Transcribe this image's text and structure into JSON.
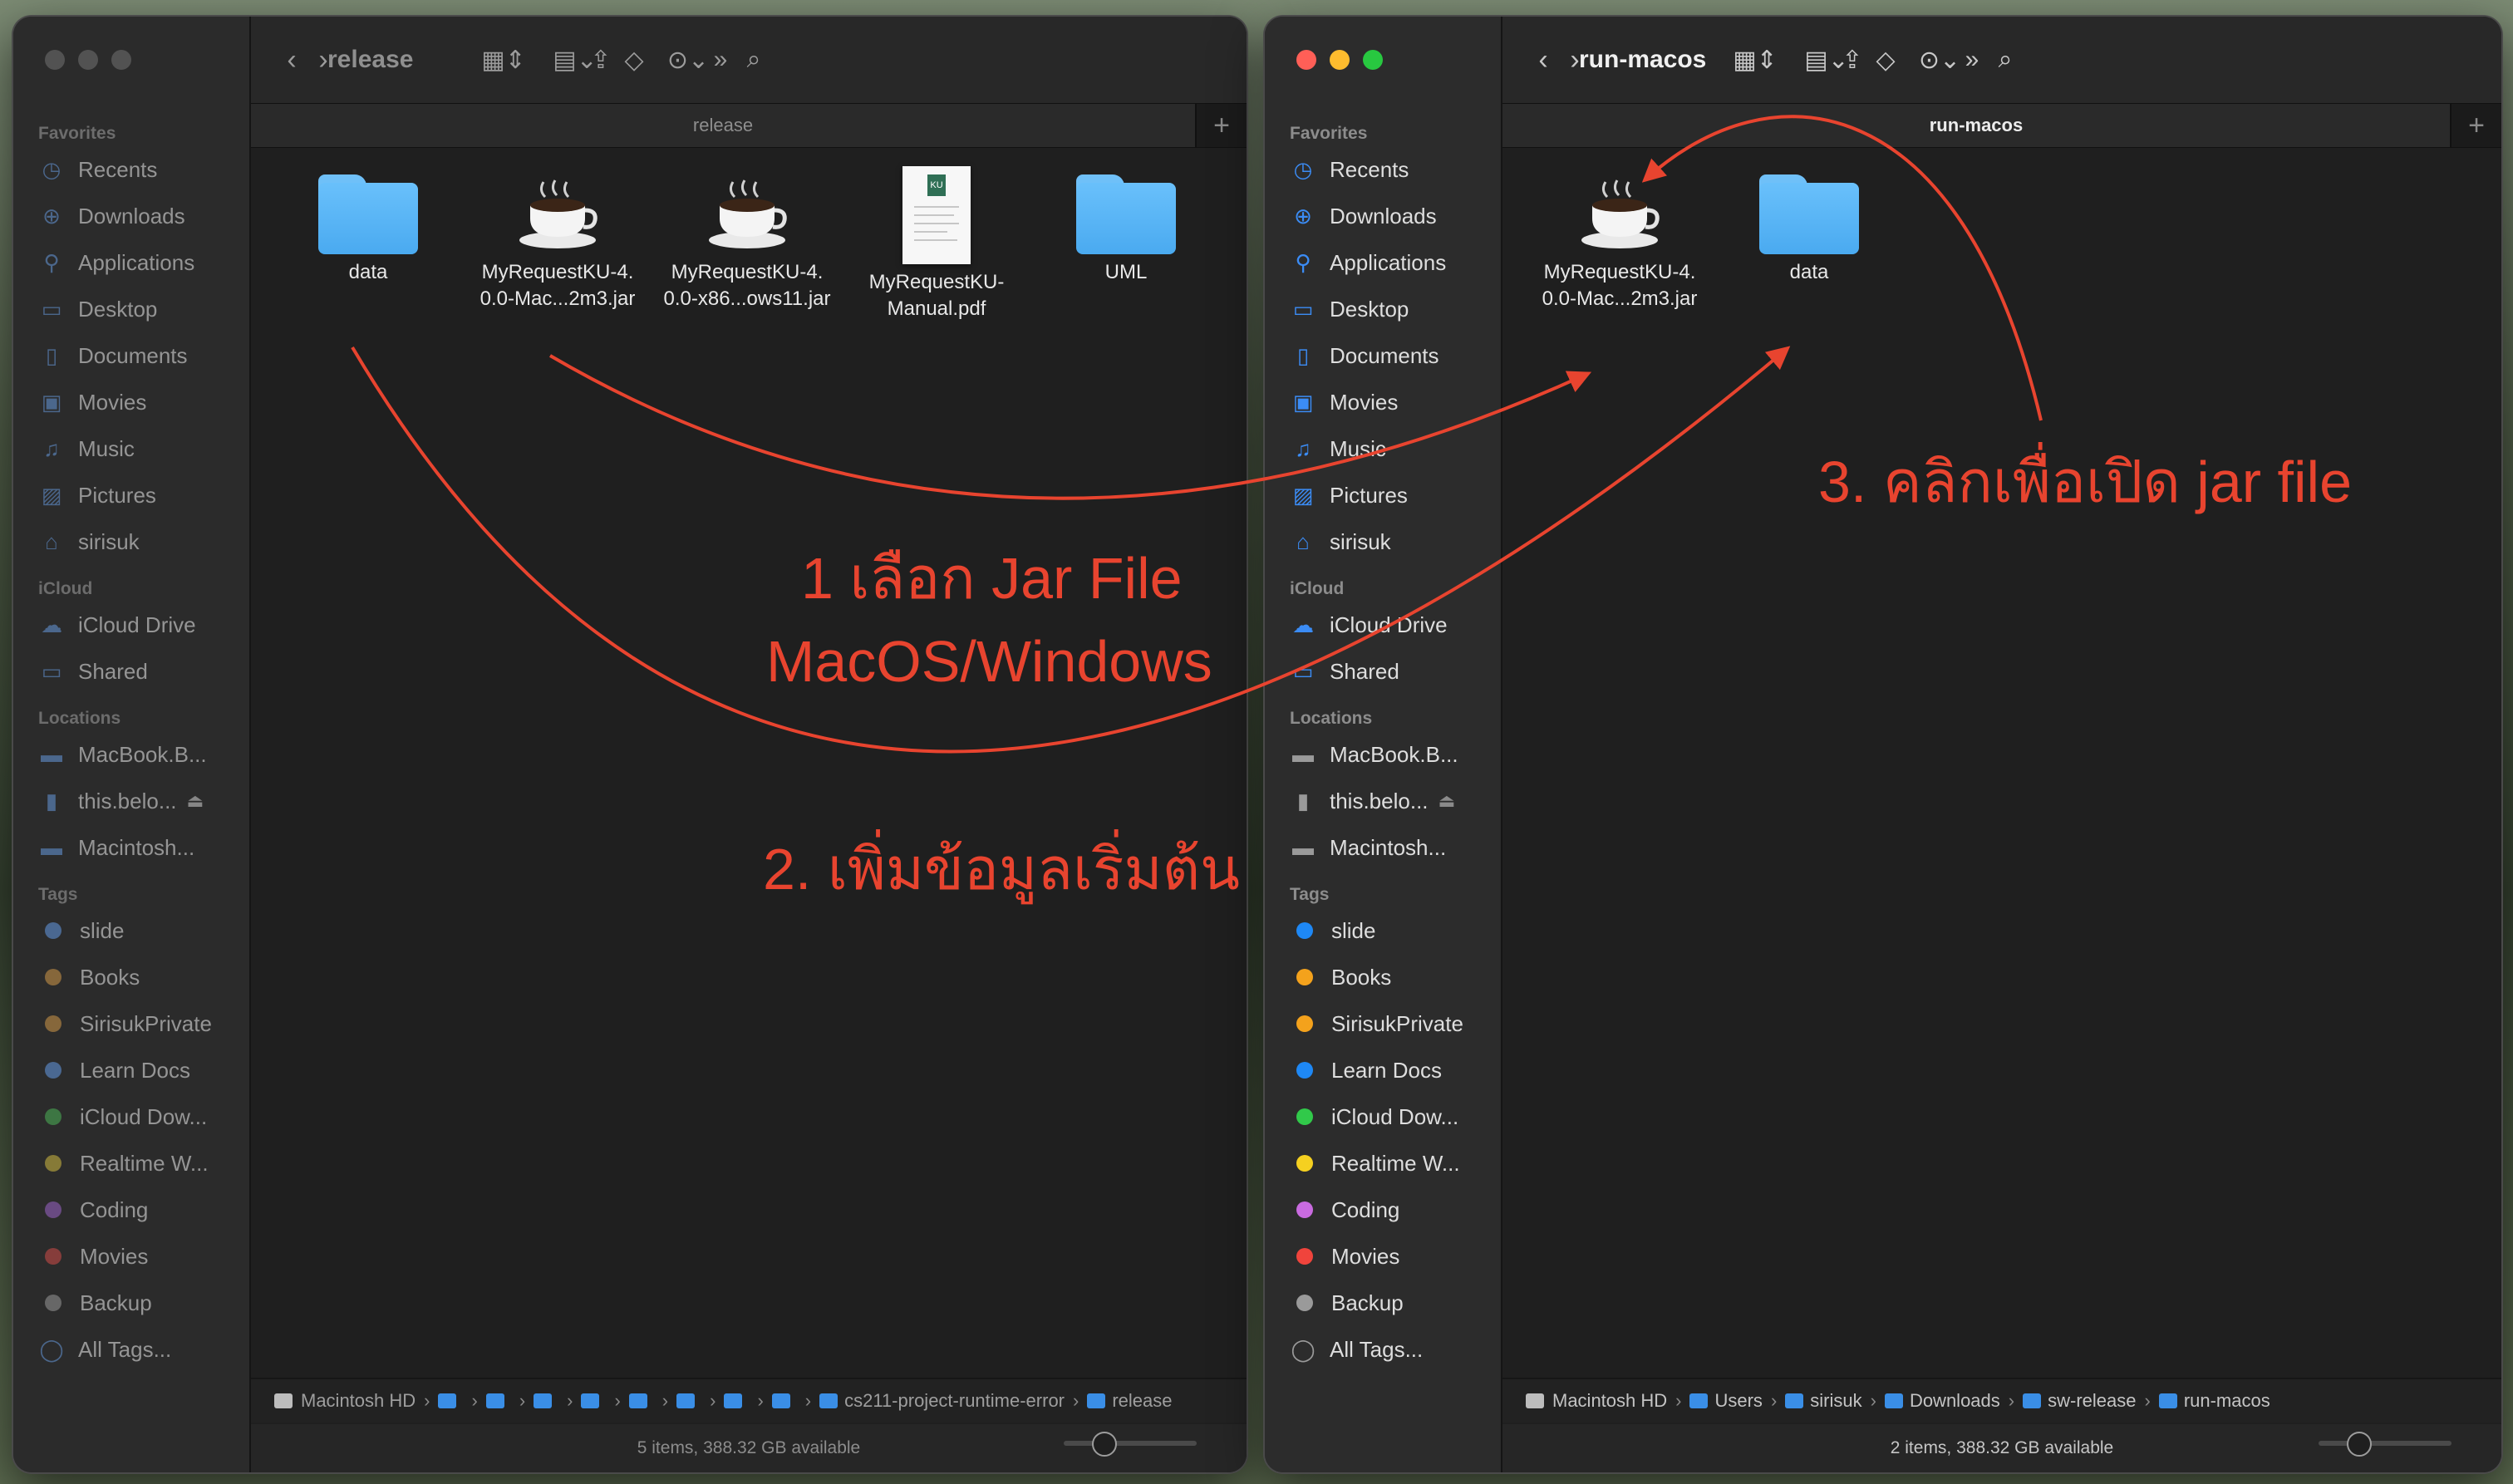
{
  "left_window": {
    "title": "release",
    "tab_label": "release",
    "sidebar": [
      {
        "type": "heading",
        "label": "Favorites"
      },
      {
        "type": "item",
        "label": "Recents",
        "icon": "clock-icon"
      },
      {
        "type": "item",
        "label": "Downloads",
        "icon": "download-icon"
      },
      {
        "type": "item",
        "label": "Applications",
        "icon": "applications-icon"
      },
      {
        "type": "item",
        "label": "Desktop",
        "icon": "desktop-icon"
      },
      {
        "type": "item",
        "label": "Documents",
        "icon": "document-icon"
      },
      {
        "type": "item",
        "label": "Movies",
        "icon": "film-icon"
      },
      {
        "type": "item",
        "label": "Music",
        "icon": "music-icon"
      },
      {
        "type": "item",
        "label": "Pictures",
        "icon": "photo-icon"
      },
      {
        "type": "item",
        "label": "sirisuk",
        "icon": "home-icon"
      },
      {
        "type": "heading",
        "label": "iCloud"
      },
      {
        "type": "item",
        "label": "iCloud Drive",
        "icon": "cloud-icon"
      },
      {
        "type": "item",
        "label": "Shared",
        "icon": "shared-folder-icon"
      },
      {
        "type": "heading",
        "label": "Locations"
      },
      {
        "type": "item",
        "label": "MacBook.B...",
        "icon": "laptop-icon"
      },
      {
        "type": "item",
        "label": "this.belo...",
        "icon": "drive-icon",
        "eject": true
      },
      {
        "type": "item",
        "label": "Macintosh...",
        "icon": "disk-icon"
      },
      {
        "type": "heading",
        "label": "Tags"
      },
      {
        "type": "tag",
        "label": "slide",
        "color": "#4c6b96"
      },
      {
        "type": "tag",
        "label": "Books",
        "color": "#8a6a3c"
      },
      {
        "type": "tag",
        "label": "SirisukPrivate",
        "color": "#8a6a3c"
      },
      {
        "type": "tag",
        "label": "Learn Docs",
        "color": "#4c6b96"
      },
      {
        "type": "tag",
        "label": "iCloud Dow...",
        "color": "#3f7a45"
      },
      {
        "type": "tag",
        "label": "Realtime W...",
        "color": "#8a7e38"
      },
      {
        "type": "tag",
        "label": "Coding",
        "color": "#6c4c86"
      },
      {
        "type": "tag",
        "label": "Movies",
        "color": "#8a3f3c"
      },
      {
        "type": "tag",
        "label": "Backup",
        "color": "#6a6a6a"
      },
      {
        "type": "item",
        "label": "All Tags...",
        "icon": "tags-icon"
      }
    ],
    "files": [
      {
        "name": "data",
        "kind": "folder"
      },
      {
        "name": "MyRequestKU-4.\n0.0-Mac...2m3.jar",
        "kind": "jar"
      },
      {
        "name": "MyRequestKU-4.\n0.0-x86...ows11.jar",
        "kind": "jar"
      },
      {
        "name": "MyRequestKU-\nManual.pdf",
        "kind": "pdf"
      },
      {
        "name": "UML",
        "kind": "folder"
      }
    ],
    "path": [
      "Macintosh HD",
      "",
      "",
      "",
      "",
      "",
      "",
      "",
      "",
      "cs211-project-runtime-error",
      "release"
    ],
    "status": "5 items, 388.32 GB available"
  },
  "right_window": {
    "title": "run-macos",
    "tab_label": "run-macos",
    "sidebar": [
      {
        "type": "heading",
        "label": "Favorites"
      },
      {
        "type": "item",
        "label": "Recents",
        "icon": "clock-icon"
      },
      {
        "type": "item",
        "label": "Downloads",
        "icon": "download-icon"
      },
      {
        "type": "item",
        "label": "Applications",
        "icon": "applications-icon"
      },
      {
        "type": "item",
        "label": "Desktop",
        "icon": "desktop-icon"
      },
      {
        "type": "item",
        "label": "Documents",
        "icon": "document-icon"
      },
      {
        "type": "item",
        "label": "Movies",
        "icon": "film-icon"
      },
      {
        "type": "item",
        "label": "Music",
        "icon": "music-icon"
      },
      {
        "type": "item",
        "label": "Pictures",
        "icon": "photo-icon"
      },
      {
        "type": "item",
        "label": "sirisuk",
        "icon": "home-icon"
      },
      {
        "type": "heading",
        "label": "iCloud"
      },
      {
        "type": "item",
        "label": "iCloud Drive",
        "icon": "cloud-icon"
      },
      {
        "type": "item",
        "label": "Shared",
        "icon": "shared-folder-icon"
      },
      {
        "type": "heading",
        "label": "Locations"
      },
      {
        "type": "item",
        "label": "MacBook.B...",
        "icon": "laptop-icon"
      },
      {
        "type": "item",
        "label": "this.belo...",
        "icon": "drive-icon",
        "eject": true
      },
      {
        "type": "item",
        "label": "Macintosh...",
        "icon": "disk-icon"
      },
      {
        "type": "heading",
        "label": "Tags"
      },
      {
        "type": "tag",
        "label": "slide",
        "color": "#1e88f5"
      },
      {
        "type": "tag",
        "label": "Books",
        "color": "#f4a21c"
      },
      {
        "type": "tag",
        "label": "SirisukPrivate",
        "color": "#f4a21c"
      },
      {
        "type": "tag",
        "label": "Learn Docs",
        "color": "#1e88f5"
      },
      {
        "type": "tag",
        "label": "iCloud Dow...",
        "color": "#31c94a"
      },
      {
        "type": "tag",
        "label": "Realtime W...",
        "color": "#f5d020"
      },
      {
        "type": "tag",
        "label": "Coding",
        "color": "#c96be0"
      },
      {
        "type": "tag",
        "label": "Movies",
        "color": "#f0443c"
      },
      {
        "type": "tag",
        "label": "Backup",
        "color": "#9a9a9a"
      },
      {
        "type": "item",
        "label": "All Tags...",
        "icon": "tags-icon"
      }
    ],
    "files": [
      {
        "name": "MyRequestKU-4.\n0.0-Mac...2m3.jar",
        "kind": "jar"
      },
      {
        "name": "data",
        "kind": "folder"
      }
    ],
    "path": [
      "Macintosh HD",
      "Users",
      "sirisuk",
      "Downloads",
      "sw-release",
      "run-macos"
    ],
    "status": "2 items, 388.32 GB available"
  },
  "annotations": {
    "step1_line1": "1 เลือก Jar File",
    "step1_line2": "MacOS/Windows",
    "step2": "2. เพิ่มข้อมูลเริ่มต้น",
    "step3": "3. คลิกเพื่อเปิด jar file",
    "color": "#e8442f"
  }
}
